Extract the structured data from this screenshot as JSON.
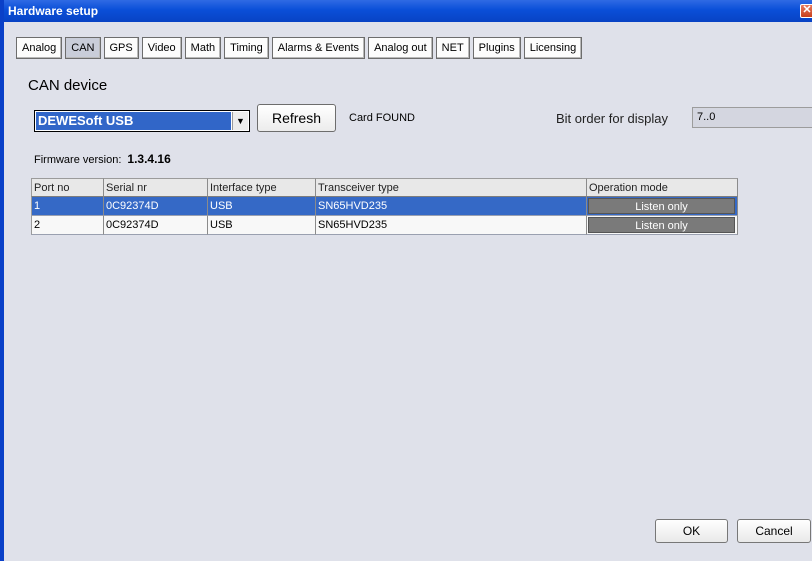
{
  "window": {
    "title": "Hardware setup",
    "close_glyph": "✕"
  },
  "tabs": [
    {
      "label": "Analog"
    },
    {
      "label": "CAN"
    },
    {
      "label": "GPS"
    },
    {
      "label": "Video"
    },
    {
      "label": "Math"
    },
    {
      "label": "Timing"
    },
    {
      "label": "Alarms & Events"
    },
    {
      "label": "Analog out"
    },
    {
      "label": "NET"
    },
    {
      "label": "Plugins"
    },
    {
      "label": "Licensing"
    }
  ],
  "active_tab": "CAN",
  "device": {
    "section_title": "CAN device",
    "selected": "DEWESoft USB",
    "refresh_label": "Refresh",
    "status": "Card FOUND"
  },
  "bit_order": {
    "label": "Bit order for display",
    "value": "7..0"
  },
  "firmware": {
    "label": "Firmware version:",
    "value": "1.3.4.16"
  },
  "table": {
    "headers": [
      "Port no",
      "Serial nr",
      "Interface type",
      "Transceiver type",
      "Operation mode"
    ],
    "rows": [
      {
        "port": "1",
        "serial": "0C92374D",
        "interface": "USB",
        "transceiver": "SN65HVD235",
        "mode": "Listen only"
      },
      {
        "port": "2",
        "serial": "0C92374D",
        "interface": "USB",
        "transceiver": "SN65HVD235",
        "mode": "Listen only"
      }
    ]
  },
  "footer": {
    "ok_label": "OK",
    "cancel_label": "Cancel"
  },
  "colors": {
    "titlebar": "#0a4fd8",
    "selection": "#3569c6",
    "background": "#dfe1ea"
  }
}
